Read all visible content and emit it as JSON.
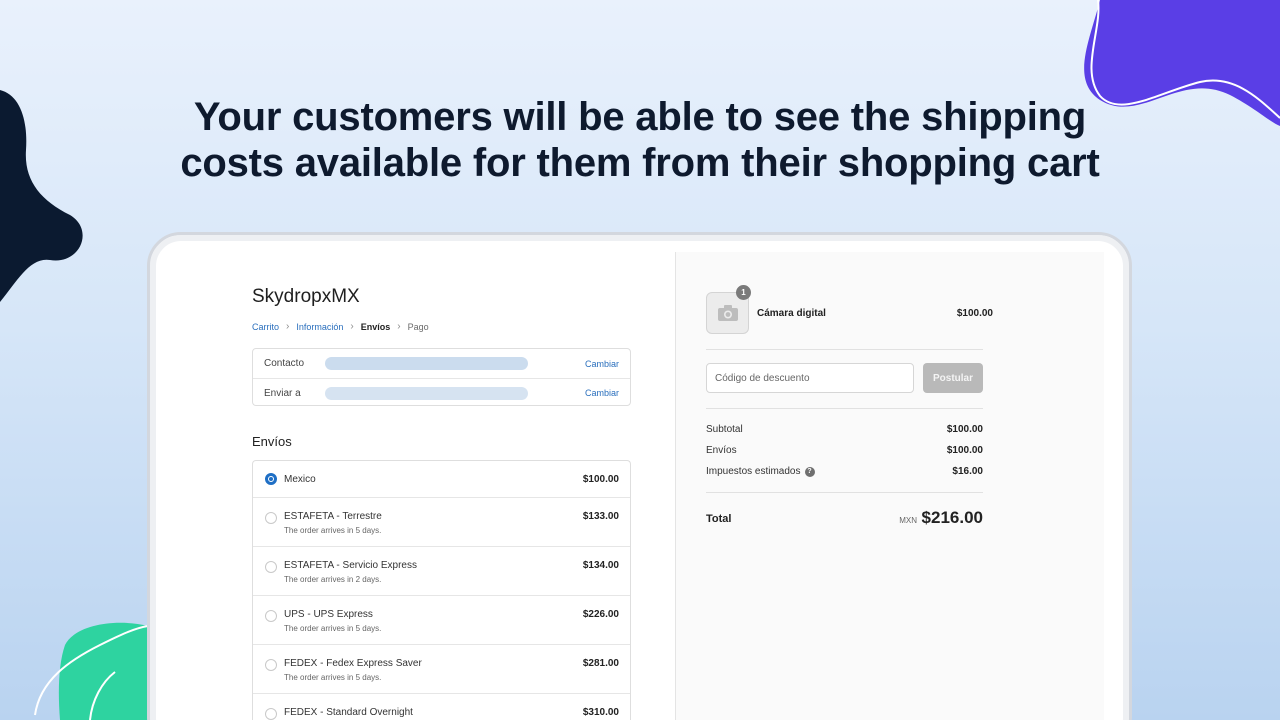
{
  "headline": {
    "line1": "Your customers will be able to see the shipping",
    "line2": "costs available for them from their shopping cart"
  },
  "colors": {
    "accent": "#1f6fc5",
    "link": "#2a6fbd",
    "blob_purple": "#5a3ee6",
    "blob_navy": "#0b1a30",
    "blob_green": "#2ed3a0"
  },
  "checkout": {
    "store_name": "SkydropxMX",
    "breadcrumbs": {
      "cart": "Carrito",
      "information": "Información",
      "shipping": "Envíos",
      "payment": "Pago"
    },
    "info": {
      "contact_label": "Contacto",
      "ship_to_label": "Enviar a",
      "change_label": "Cambiar"
    },
    "shipping_title": "Envíos",
    "options": [
      {
        "name": "Mexico",
        "detail": "",
        "price": "$100.00",
        "selected": true
      },
      {
        "name": "ESTAFETA - Terrestre",
        "detail": "The order arrives in 5 days.",
        "price": "$133.00",
        "selected": false
      },
      {
        "name": "ESTAFETA - Servicio Express",
        "detail": "The order arrives in 2 days.",
        "price": "$134.00",
        "selected": false
      },
      {
        "name": "UPS - UPS Express",
        "detail": "The order arrives in 5 days.",
        "price": "$226.00",
        "selected": false
      },
      {
        "name": "FEDEX - Fedex Express Saver",
        "detail": "The order arrives in 5 days.",
        "price": "$281.00",
        "selected": false
      },
      {
        "name": "FEDEX - Standard Overnight",
        "detail": "",
        "price": "$310.00",
        "selected": false
      }
    ]
  },
  "summary": {
    "product": {
      "quantity": "1",
      "name": "Cámara digital",
      "price": "$100.00",
      "icon": "camera-icon"
    },
    "discount": {
      "placeholder": "Código de descuento",
      "apply_label": "Postular"
    },
    "subtotal_label": "Subtotal",
    "subtotal_value": "$100.00",
    "shipping_label": "Envíos",
    "shipping_value": "$100.00",
    "taxes_label": "Impuestos estimados",
    "taxes_help": "?",
    "taxes_value": "$16.00",
    "total_label": "Total",
    "total_currency": "MXN",
    "total_value": "$216.00"
  }
}
